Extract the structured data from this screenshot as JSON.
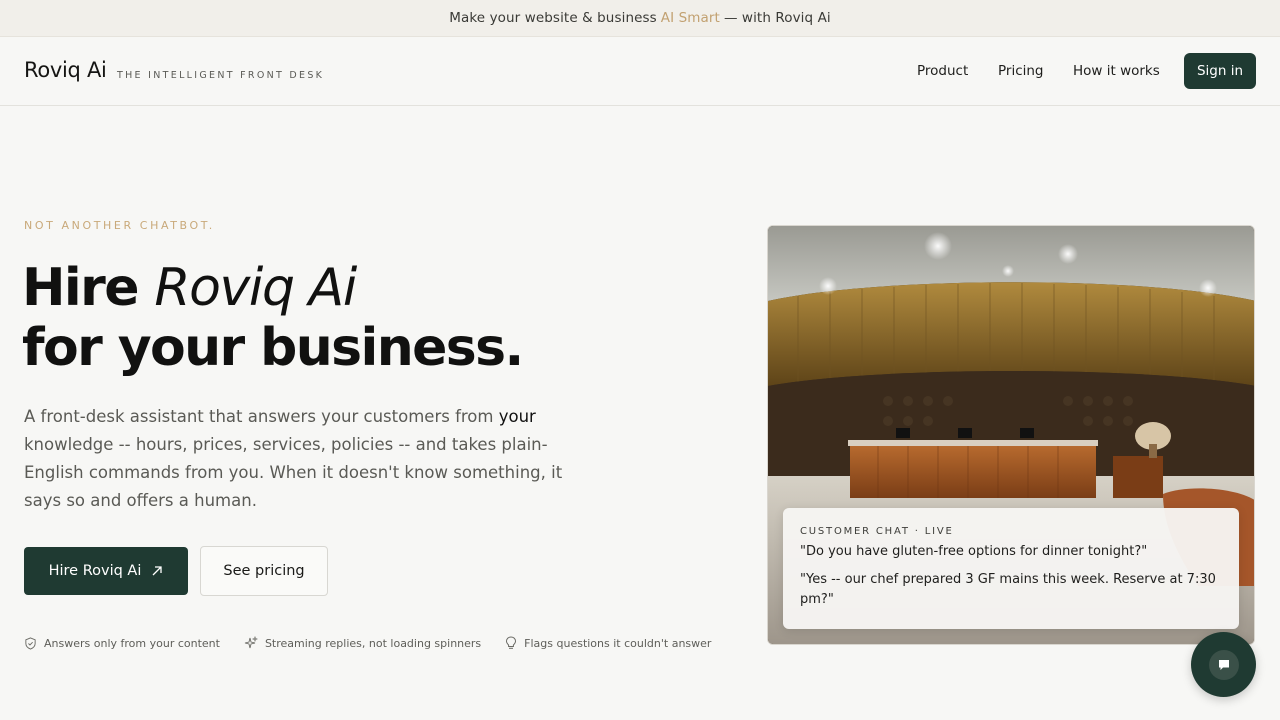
{
  "announcement": {
    "prefix": "Make your website & business",
    "highlight": "AI Smart",
    "suffix": "— with Roviq Ai",
    "accent_color": "#c2a171"
  },
  "header": {
    "brand": "Roviq Ai",
    "tagline": "THE INTELLIGENT FRONT DESK",
    "nav": [
      "Product",
      "Pricing",
      "How it works"
    ],
    "signin_label": "Sign in"
  },
  "hero": {
    "eyebrow": "NOT ANOTHER CHATBOT.",
    "headline_word1": "Hire",
    "headline_italic": "Roviq Ai",
    "headline_line2": "for your business.",
    "lead_part1": "A front-desk assistant that answers your customers from",
    "lead_strong": "your",
    "lead_part2": "knowledge -- hours, prices, services, policies -- and takes plain-English commands from you. When it doesn't know something, it says so and offers a human.",
    "primary_cta": "Hire Roviq Ai",
    "secondary_cta": "See pricing",
    "features": [
      {
        "icon": "shield-check-icon",
        "label": "Answers only from your content"
      },
      {
        "icon": "sparkle-icon",
        "label": "Streaming replies, not loading spinners"
      },
      {
        "icon": "lightbulb-icon",
        "label": "Flags questions it couldn't answer"
      }
    ]
  },
  "chat_preview": {
    "label": "CUSTOMER CHAT · LIVE",
    "question": "\"Do you have gluten-free options for dinner tonight?\"",
    "answer": "\"Yes -- our chef prepared 3 GF mains this week. Reserve at 7:30 pm?\""
  },
  "colors": {
    "brand_dark": "#1f3a32",
    "eyebrow": "#c9a97a",
    "background": "#f7f7f5"
  }
}
